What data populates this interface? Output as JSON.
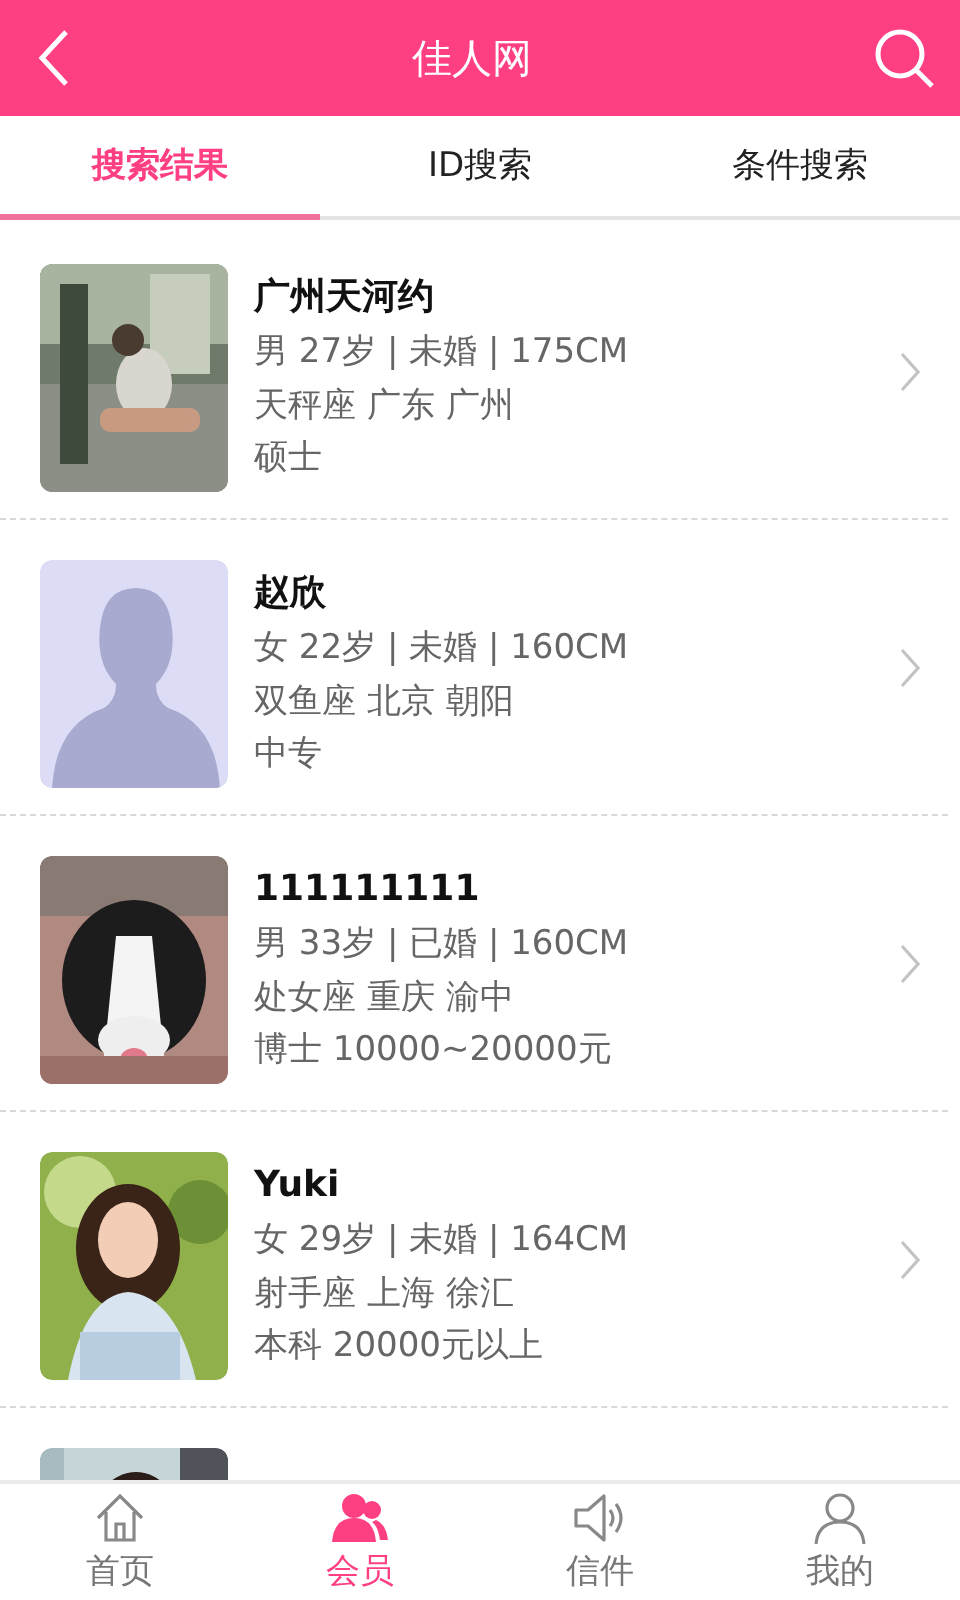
{
  "header": {
    "title": "佳人网"
  },
  "tabs": [
    {
      "label": "搜索结果",
      "selected": true
    },
    {
      "label": "ID搜索",
      "selected": false
    },
    {
      "label": "条件搜索",
      "selected": false
    }
  ],
  "members": [
    {
      "kind": "picture",
      "name": "广州天河约",
      "details": "男 27岁 | 未婚 | 175CM",
      "location": "天秤座 广东 广州",
      "education": "硕士"
    },
    {
      "kind": "placeholder",
      "name": "赵欣",
      "details": "女 22岁 | 未婚 | 160CM",
      "location": "双鱼座 北京 朝阳",
      "education": "中专"
    },
    {
      "kind": "picture",
      "name": "111111111",
      "details": "男 33岁 | 已婚 | 160CM",
      "location": "处女座 重庆 渝中",
      "education": "博士 10000~20000元"
    },
    {
      "kind": "picture",
      "name": "Yuki",
      "details": "女 29岁 | 未婚 | 164CM",
      "location": "射手座 上海 徐汇",
      "education": "本科 20000元以上"
    },
    {
      "kind": "picture"
    }
  ],
  "nav": [
    {
      "label": "首页",
      "selected": false
    },
    {
      "label": "会员",
      "selected": true
    },
    {
      "label": "信件",
      "selected": false
    },
    {
      "label": "我的",
      "selected": false
    }
  ]
}
